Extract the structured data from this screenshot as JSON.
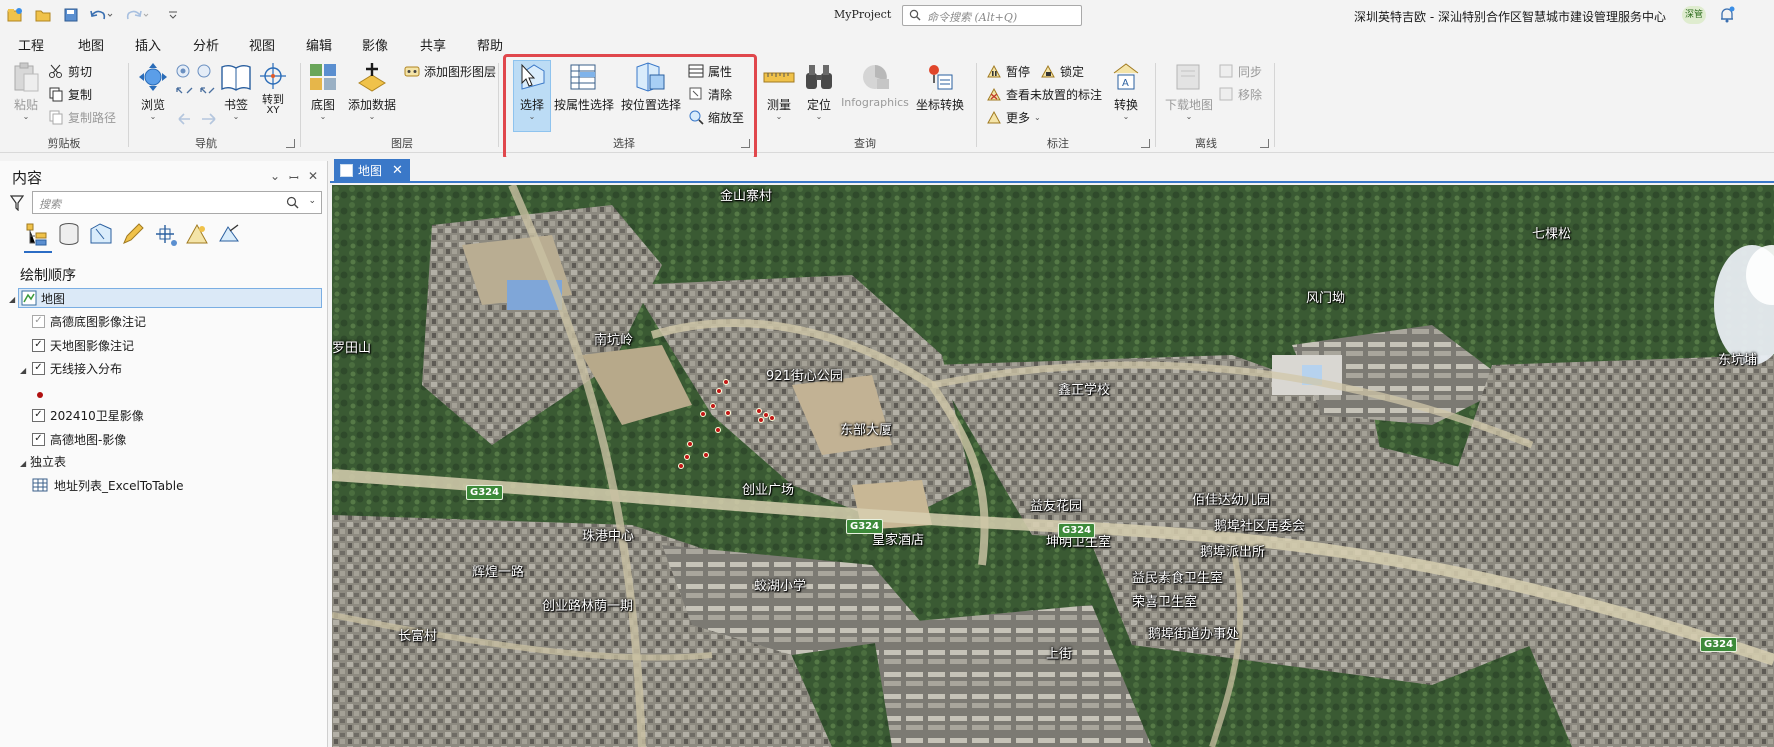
{
  "titlebar": {
    "project": "MyProject",
    "search_placeholder": "命令搜索 (Alt+Q)",
    "org": "深圳英特吉欧 - 深汕特别合作区智慧城市建设管理服务中心",
    "avatar": "深管"
  },
  "tabs": [
    "工程",
    "地图",
    "插入",
    "分析",
    "视图",
    "编辑",
    "影像",
    "共享",
    "帮助"
  ],
  "active_tab": "地图",
  "ribbon": {
    "clipboard": {
      "paste": "粘贴",
      "cut": "剪切",
      "copy": "复制",
      "copy_path": "复制路径",
      "group": "剪贴板"
    },
    "navigate": {
      "explore": "浏览",
      "bookmarks": "书签",
      "goto_xy": "转到\nXY",
      "group": "导航"
    },
    "layer": {
      "basemap": "底图",
      "add_data": "添加数据",
      "add_graphics": "添加图形图层",
      "group": "图层"
    },
    "selection": {
      "select": "选择",
      "by_attr": "按属性选择",
      "by_loc": "按位置选择",
      "attributes": "属性",
      "clear": "清除",
      "zoom_to": "缩放至",
      "group": "选择"
    },
    "inquiry": {
      "measure": "测量",
      "locate": "定位",
      "infographics": "Infographics",
      "convert_coords": "坐标转换",
      "group": "查询"
    },
    "labeling": {
      "pause": "暂停",
      "lock": "锁定",
      "view_unplaced": "查看未放置的标注",
      "more": "更多",
      "convert": "转换",
      "group": "标注"
    },
    "offline": {
      "download_map": "下载地图",
      "sync": "同步",
      "remove": "移除",
      "group": "离线"
    }
  },
  "contents": {
    "title": "内容",
    "search_placeholder": "搜索",
    "drawing_order": "绘制顺序",
    "map_name": "地图",
    "layers": [
      {
        "label": "高德底图影像注记",
        "checked": true
      },
      {
        "label": "天地图影像注记",
        "checked": true
      },
      {
        "label": "无线接入分布",
        "checked": true
      },
      {
        "label": "202410卫星影像",
        "checked": true
      },
      {
        "label": "高德地图-影像",
        "checked": true
      }
    ],
    "standalone_tables": "独立表",
    "table_item": "地址列表_ExcelToTable"
  },
  "map_tab": {
    "label": "地图"
  },
  "map_labels": {
    "jinshan": "金山寨村",
    "qikesong": "七棵松",
    "fengmen": "风门坳",
    "luotian": "罗田山",
    "nankeng": "南坑岭",
    "park921": "921街心公园",
    "dongbu": "东部大厦",
    "dongchuan": "东坑埔",
    "xinzheng": "鑫正学校",
    "jiaye": "创业广场",
    "qilin": "珠港中心",
    "yiyou": "益友花园",
    "huangjia": "皇家酒店",
    "kunming": "坤明卫生室",
    "peixin": "佰佳达幼儿园",
    "juyuan": "鹅埠社区居委会",
    "paichu": "鹅埠派出所",
    "yimin": "益民素食卫生室",
    "rongxi": "荣喜卫生室",
    "xihu": "蛟湖小学",
    "changyu": "长富村",
    "chuangye": "创业路林荫一期",
    "etouzhen": "鹅埠街道办事处",
    "shangjie": "上街",
    "fuxin": "辉煌一路",
    "g324": "G324"
  }
}
